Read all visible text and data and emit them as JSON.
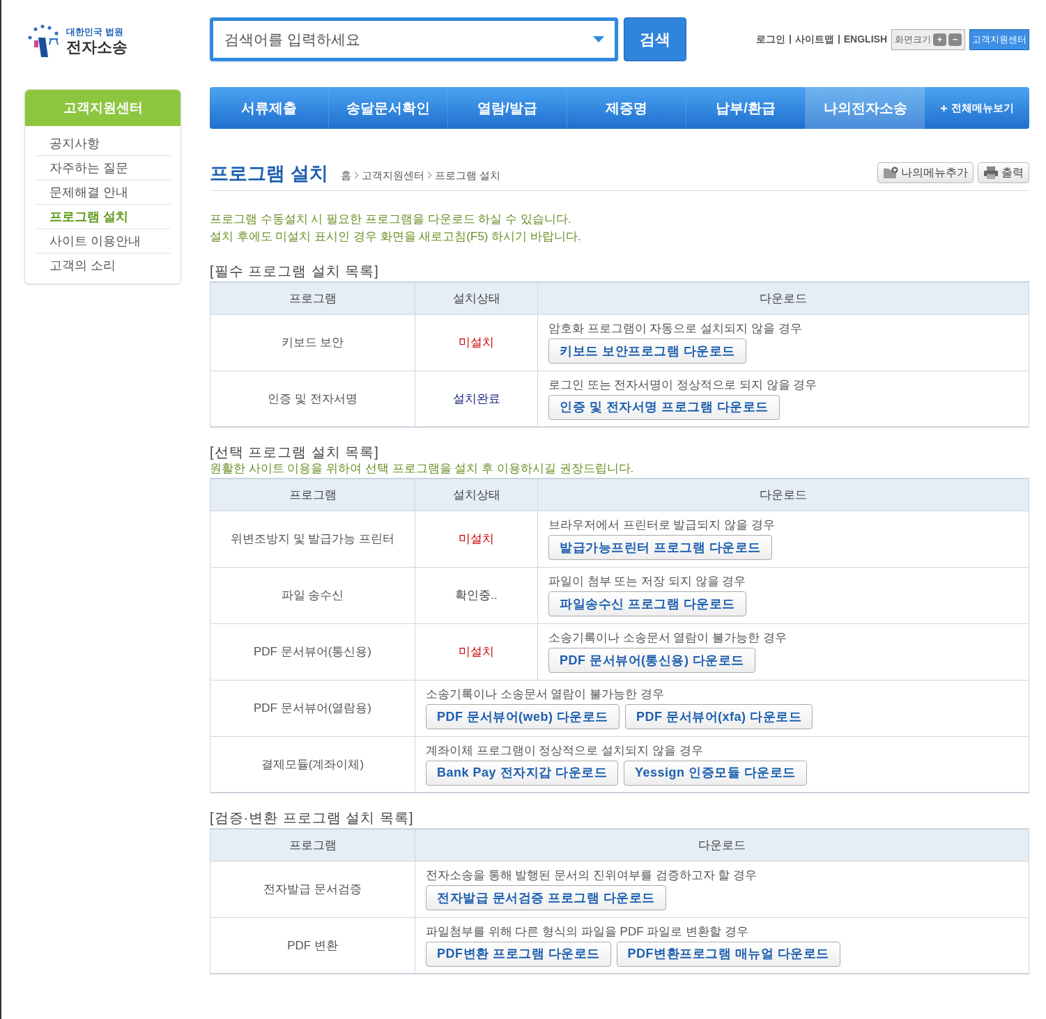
{
  "logo": {
    "top": "대한민국 법원",
    "main": "전자소송"
  },
  "search": {
    "placeholder": "검색어를 입력하세요",
    "button": "검색"
  },
  "util_links": [
    "로그인",
    "사이트맵",
    "ENGLISH"
  ],
  "font_size": {
    "label": "화면크기",
    "plus": "+",
    "minus": "−"
  },
  "support_button": "고객지원센터",
  "sidebar": {
    "title": "고객지원센터",
    "items": [
      {
        "label": "공지사항",
        "selected": false
      },
      {
        "label": "자주하는 질문",
        "selected": false
      },
      {
        "label": "문제해결 안내",
        "selected": false
      },
      {
        "label": "프로그램 설치",
        "selected": true
      },
      {
        "label": "사이트 이용안내",
        "selected": false
      },
      {
        "label": "고객의 소리",
        "selected": false
      }
    ]
  },
  "nav": {
    "items": [
      {
        "label": "서류제출",
        "selected": false
      },
      {
        "label": "송달문서확인",
        "selected": false
      },
      {
        "label": "열람/발급",
        "selected": false
      },
      {
        "label": "제증명",
        "selected": false
      },
      {
        "label": "납부/환급",
        "selected": false
      },
      {
        "label": "나의전자소송",
        "selected": true
      }
    ],
    "all_menu": "전체메뉴보기"
  },
  "page": {
    "title": "프로그램 설치",
    "breadcrumb": [
      "홈",
      "고객지원센터",
      "프로그램 설치"
    ],
    "actions": [
      "나의메뉴추가",
      "출력"
    ]
  },
  "intro": [
    "프로그램 수동설치 시 필요한 프로그램을 다운로드 하실 수 있습니다.",
    "설치 후에도 미설치 표시인 경우 화면을 새로고침(F5) 하시기 바랍니다."
  ],
  "sections": [
    {
      "title": "[필수 프로그램 설치 목록]",
      "columns": [
        "프로그램",
        "설치상태",
        "다운로드"
      ],
      "rows": [
        {
          "program": "키보드 보안",
          "status": {
            "text": "미설치",
            "kind": "missing"
          },
          "note": "암호화 프로그램이 자동으로 설치되지 않을 경우",
          "buttons": [
            "키보드 보안프로그램 다운로드"
          ]
        },
        {
          "program": "인증 및 전자서명",
          "status": {
            "text": "설치완료",
            "kind": "installed"
          },
          "note": "로그인 또는 전자서명이 정상적으로 되지 않을 경우",
          "buttons": [
            "인증 및 전자서명 프로그램 다운로드"
          ]
        }
      ]
    },
    {
      "title": "[선택 프로그램 설치 목록]",
      "subtitle": "원활한 사이트 이용을 위하여 선택 프로그램을 설치 후 이용하시길 권장드립니다.",
      "columns": [
        "프로그램",
        "설치상태",
        "다운로드"
      ],
      "rows": [
        {
          "program": "위변조방지 및 발급가능 프린터",
          "status": {
            "text": "미설치",
            "kind": "missing"
          },
          "note": "브라우저에서 프린터로 발급되지 않을 경우",
          "buttons": [
            "발급가능프린터 프로그램 다운로드"
          ]
        },
        {
          "program": "파일 송수신",
          "status": {
            "text": "확인중..",
            "kind": "checking"
          },
          "note": "파일이 첨부 또는 저장 되지 않을 경우",
          "buttons": [
            "파일송수신 프로그램 다운로드"
          ]
        },
        {
          "program": "PDF 문서뷰어(통신용)",
          "status": {
            "text": "미설치",
            "kind": "missing"
          },
          "note": "소송기록이나 소송문서 열람이 불가능한 경우",
          "buttons": [
            "PDF 문서뷰어(통신용) 다운로드"
          ]
        },
        {
          "program": "PDF 문서뷰어(열람용)",
          "note": "소송기록이나 소송문서 열람이 불가능한 경우",
          "buttons": [
            "PDF 문서뷰어(web) 다운로드",
            "PDF 문서뷰어(xfa) 다운로드"
          ]
        },
        {
          "program": "결제모듈(계좌이체)",
          "note": "계좌이체 프로그램이 정상적으로 설치되지 않을 경우",
          "buttons": [
            "Bank Pay 전자지갑 다운로드",
            "Yessign 인증모듈 다운로드"
          ]
        }
      ]
    },
    {
      "title": "[검증·변환 프로그램 설치 목록]",
      "columns": [
        "프로그램",
        "다운로드"
      ],
      "rows": [
        {
          "program": "전자발급 문서검증",
          "note": "전자소송을 통해 발행된 문서의 진위여부를 검증하고자 할 경우",
          "buttons": [
            "전자발급 문서검증 프로그램 다운로드"
          ]
        },
        {
          "program": "PDF 변환",
          "note": "파일첨부를 위해 다른 형식의 파일을 PDF 파일로 변환할 경우",
          "buttons": [
            "PDF변환 프로그램 다운로드",
            "PDF변환프로그램 매뉴얼 다운로드"
          ]
        }
      ]
    }
  ]
}
